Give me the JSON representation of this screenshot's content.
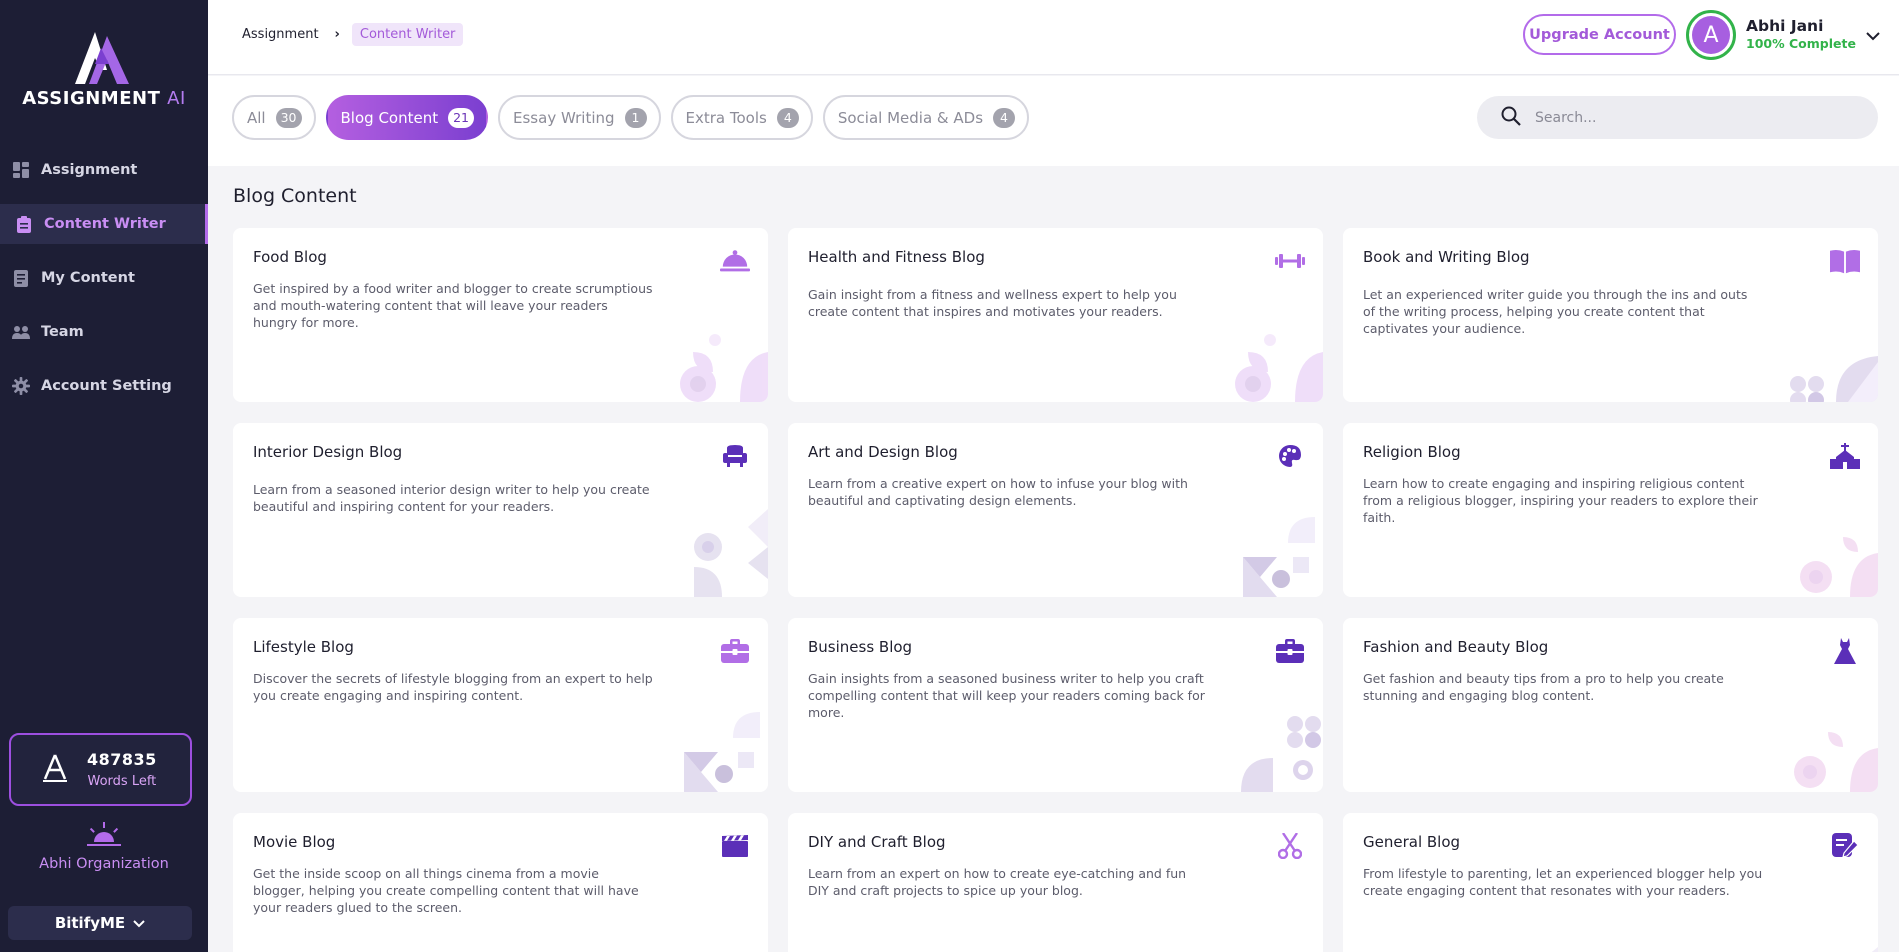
{
  "brand": {
    "name": "ASSIGNMENT",
    "name_ai": "AI"
  },
  "sidebar": {
    "items": [
      {
        "label": "Assignment",
        "icon": "dashboard-icon"
      },
      {
        "label": "Content Writer",
        "icon": "clipboard-icon",
        "active": true
      },
      {
        "label": "My Content",
        "icon": "document-icon"
      },
      {
        "label": "Team",
        "icon": "team-icon"
      },
      {
        "label": "Account Setting",
        "icon": "gear-icon"
      }
    ],
    "words_count": "487835",
    "words_label": "Words Left",
    "org_name": "Abhi Organization",
    "org_select": "BitifyME"
  },
  "header": {
    "breadcrumb": [
      "Assignment",
      "Content Writer"
    ],
    "upgrade_label": "Upgrade Account",
    "avatar_letter": "A",
    "user_name": "Abhi Jani",
    "user_status": "100% Complete"
  },
  "tabs": [
    {
      "label": "All",
      "count": "30"
    },
    {
      "label": "Blog Content",
      "count": "21",
      "active": true
    },
    {
      "label": "Essay Writing",
      "count": "1"
    },
    {
      "label": "Extra Tools",
      "count": "4"
    },
    {
      "label": "Social Media & ADs",
      "count": "4"
    }
  ],
  "search": {
    "placeholder": "Search..."
  },
  "section_title": "Blog Content",
  "cards": [
    {
      "title": "Food Blog",
      "desc": "Get inspired by a food writer and blogger to create scrumptious and mouth-watering content that will leave your readers hungry for more.",
      "icon": "cloche-icon"
    },
    {
      "title": "Health and Fitness Blog",
      "desc": "Gain insight from a fitness and wellness expert to help you create content that inspires and motivates your readers.",
      "icon": "dumbbell-icon"
    },
    {
      "title": "Book and Writing Blog",
      "desc": "Let an experienced writer guide you through the ins and outs of the writing process, helping you create content that captivates your audience.",
      "icon": "book-icon"
    },
    {
      "title": "Interior Design Blog",
      "desc": "Learn from a seasoned interior design writer to help you create beautiful and inspiring content for your readers.",
      "icon": "armchair-icon"
    },
    {
      "title": "Art and Design Blog",
      "desc": "Learn from a creative expert on how to infuse your blog with beautiful and captivating design elements.",
      "icon": "palette-icon"
    },
    {
      "title": "Religion Blog",
      "desc": "Learn how to create engaging and inspiring religious content from a religious blogger, inspiring your readers to explore their faith.",
      "icon": "church-icon"
    },
    {
      "title": "Lifestyle Blog",
      "desc": "Discover the secrets of lifestyle blogging from an expert to help you create engaging and inspiring content.",
      "icon": "briefcase-icon"
    },
    {
      "title": "Business Blog",
      "desc": "Gain insights from a seasoned business writer to help you craft compelling content that will keep your readers coming back for more.",
      "icon": "briefcase-icon"
    },
    {
      "title": "Fashion and Beauty Blog",
      "desc": "Get fashion and beauty tips from a pro to help you create stunning and engaging blog content.",
      "icon": "dress-icon"
    },
    {
      "title": "Movie Blog",
      "desc": "Get the inside scoop on all things cinema from a movie blogger, helping you create compelling content that will have your readers glued to the screen.",
      "icon": "clapperboard-icon"
    },
    {
      "title": "DIY and Craft Blog",
      "desc": "Learn from an expert on how to create eye-catching and fun DIY and craft projects to spice up your blog.",
      "icon": "scissors-icon"
    },
    {
      "title": "General Blog",
      "desc": "From lifestyle to parenting, let an experienced blogger help you create engaging content that resonates with your readers.",
      "icon": "edit-note-icon"
    }
  ],
  "colors": {
    "sidebar_bg": "#1d1e35",
    "accent": "#b36bea",
    "accent_dark": "#6b35b8",
    "success": "#32b34a"
  }
}
